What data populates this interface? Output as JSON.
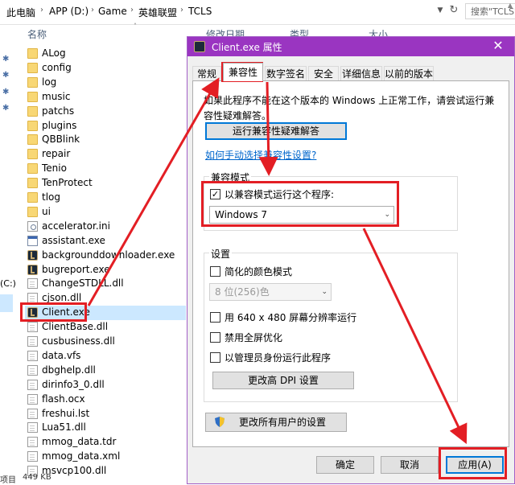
{
  "explorer": {
    "breadcrumb": [
      "此电脑",
      "APP (D:)",
      "Game",
      "英雄联盟",
      "TCLS"
    ],
    "search_placeholder": "搜索\"TCLS\"",
    "columns": {
      "name": "名称",
      "modified": "修改日期",
      "type": "类型",
      "size": "大小"
    },
    "left_drive_label": "(C:)",
    "files": [
      {
        "name": "ALog",
        "icon": "folder-icon"
      },
      {
        "name": "config",
        "icon": "folder-icon"
      },
      {
        "name": "log",
        "icon": "folder-icon"
      },
      {
        "name": "music",
        "icon": "folder-icon"
      },
      {
        "name": "patchs",
        "icon": "folder-icon"
      },
      {
        "name": "plugins",
        "icon": "folder-icon"
      },
      {
        "name": "QBBlink",
        "icon": "folder-icon"
      },
      {
        "name": "repair",
        "icon": "folder-icon"
      },
      {
        "name": "Tenio",
        "icon": "folder-icon"
      },
      {
        "name": "TenProtect",
        "icon": "folder-icon"
      },
      {
        "name": "tlog",
        "icon": "folder-icon"
      },
      {
        "name": "ui",
        "icon": "folder-icon"
      },
      {
        "name": "accelerator.ini",
        "icon": "settings-file-icon"
      },
      {
        "name": "assistant.exe",
        "icon": "exe-icon"
      },
      {
        "name": "backgrounddownloader.exe",
        "icon": "lol-app-icon"
      },
      {
        "name": "bugreport.exe",
        "icon": "lol-app-icon"
      },
      {
        "name": "ChangeSTDLL.dll",
        "icon": "dll-file-icon"
      },
      {
        "name": "cjson.dll",
        "icon": "dll-file-icon"
      },
      {
        "name": "Client.exe",
        "icon": "lol-app-icon"
      },
      {
        "name": "ClientBase.dll",
        "icon": "dll-file-icon"
      },
      {
        "name": "cusbusiness.dll",
        "icon": "dll-file-icon"
      },
      {
        "name": "data.vfs",
        "icon": "file-icon"
      },
      {
        "name": "dbghelp.dll",
        "icon": "dll-file-icon"
      },
      {
        "name": "dirinfo3_0.dll",
        "icon": "dll-file-icon"
      },
      {
        "name": "flash.ocx",
        "icon": "file-icon"
      },
      {
        "name": "freshui.lst",
        "icon": "file-icon"
      },
      {
        "name": "Lua51.dll",
        "icon": "dll-file-icon"
      },
      {
        "name": "mmog_data.tdr",
        "icon": "file-icon"
      },
      {
        "name": "mmog_data.xml",
        "icon": "file-icon"
      },
      {
        "name": "msvcp100.dll",
        "icon": "dll-file-icon"
      }
    ],
    "selected_file": "Client.exe",
    "status": {
      "count": "项目",
      "size": "449 KB"
    }
  },
  "dialog": {
    "title": "Client.exe 属性",
    "tabs": [
      "常规",
      "兼容性",
      "数字签名",
      "安全",
      "详细信息",
      "以前的版本"
    ],
    "active_tab": "兼容性",
    "intro_text": "如果此程序不能在这个版本的 Windows 上正常工作，请尝试运行兼容性疑难解答。",
    "run_troubleshooter": "运行兼容性疑难解答",
    "manual_link": "如何手动选择兼容性设置?",
    "compat_mode": {
      "group_label": "兼容模式",
      "checkbox_label": "以兼容模式运行这个程序:",
      "checked": true,
      "selected_os": "Windows 7"
    },
    "settings": {
      "group_label": "设置",
      "reduced_color": {
        "label": "简化的颜色模式",
        "checked": false
      },
      "color_option": "8 位(256)色",
      "run_640": {
        "label": "用 640 x 480 屏幕分辨率运行",
        "checked": false
      },
      "disable_fullscreen": {
        "label": "禁用全屏优化",
        "checked": false
      },
      "run_admin": {
        "label": "以管理员身份运行此程序",
        "checked": false
      },
      "dpi_button": "更改高 DPI 设置"
    },
    "all_users_button": "更改所有用户的设置",
    "ok": "确定",
    "cancel": "取消",
    "apply": "应用(A)"
  },
  "colors": {
    "titlebar": "#9a35c1",
    "annotation": "#e31e24",
    "selection": "#cce8ff",
    "link": "#0066cc"
  }
}
